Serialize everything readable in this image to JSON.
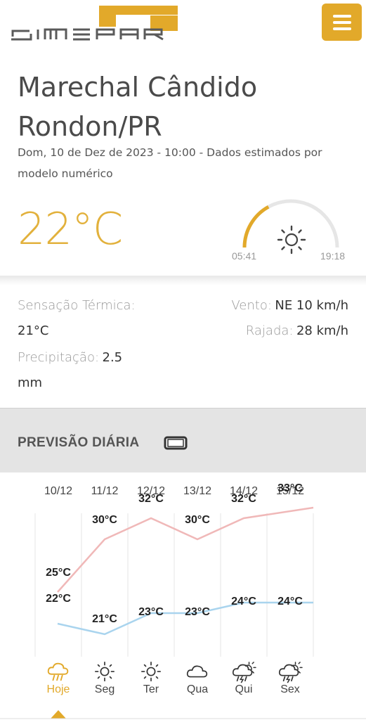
{
  "header": {
    "logo_text": "SIMEPAR",
    "menu_icon": "hamburger-icon",
    "accent": "#e2a92a"
  },
  "location": {
    "city_line1": "Marechal Cândido",
    "city_line2": "Rondon/PR",
    "dateline": "Dom, 10 de Dez de 2023 - 10:00 - Dados estimados por modelo numérico"
  },
  "current": {
    "temperature": "22°C",
    "sunrise": "05:41",
    "sunset": "19:18",
    "sun_icon": "sun-icon",
    "daylight_progress": 0.34
  },
  "details": {
    "feels_label": "Sensação Térmica:",
    "feels_value": "21°C",
    "precip_label": "Precipitação:",
    "precip_value": "2.5",
    "precip_unit": "mm",
    "wind_label": "Vento:",
    "wind_value": "NE 10 km/h",
    "gust_label": "Rajada:",
    "gust_value": "28 km/h"
  },
  "daily": {
    "title": "PREVISÃO DIÁRIA",
    "toggle_icon": "mobile-rotate-icon"
  },
  "chart_data": {
    "type": "line",
    "categories": [
      "10/12",
      "11/12",
      "12/12",
      "13/12",
      "14/12",
      "15/12"
    ],
    "days": [
      "Hoje",
      "Seg",
      "Ter",
      "Qua",
      "Qui",
      "Sex"
    ],
    "day_icons": [
      "rain-cloud-icon",
      "sun-icon",
      "sun-icon",
      "cloud-icon",
      "storm-sun-icon",
      "storm-sun-icon"
    ],
    "series": [
      {
        "values": [
          25,
          30,
          32,
          30,
          32,
          33
        ],
        "labels": [
          "25°C",
          "30°C",
          "32°C",
          "30°C",
          "32°C",
          "33°C"
        ],
        "color": "#f0b8b8"
      },
      {
        "values": [
          22,
          21,
          23,
          23,
          24,
          24
        ],
        "labels": [
          "22°C",
          "21°C",
          "23°C",
          "23°C",
          "24°C",
          "24°C"
        ],
        "color": "#a9d4ee"
      }
    ],
    "selected_day": 0,
    "selected_color": "#e2a92a"
  }
}
